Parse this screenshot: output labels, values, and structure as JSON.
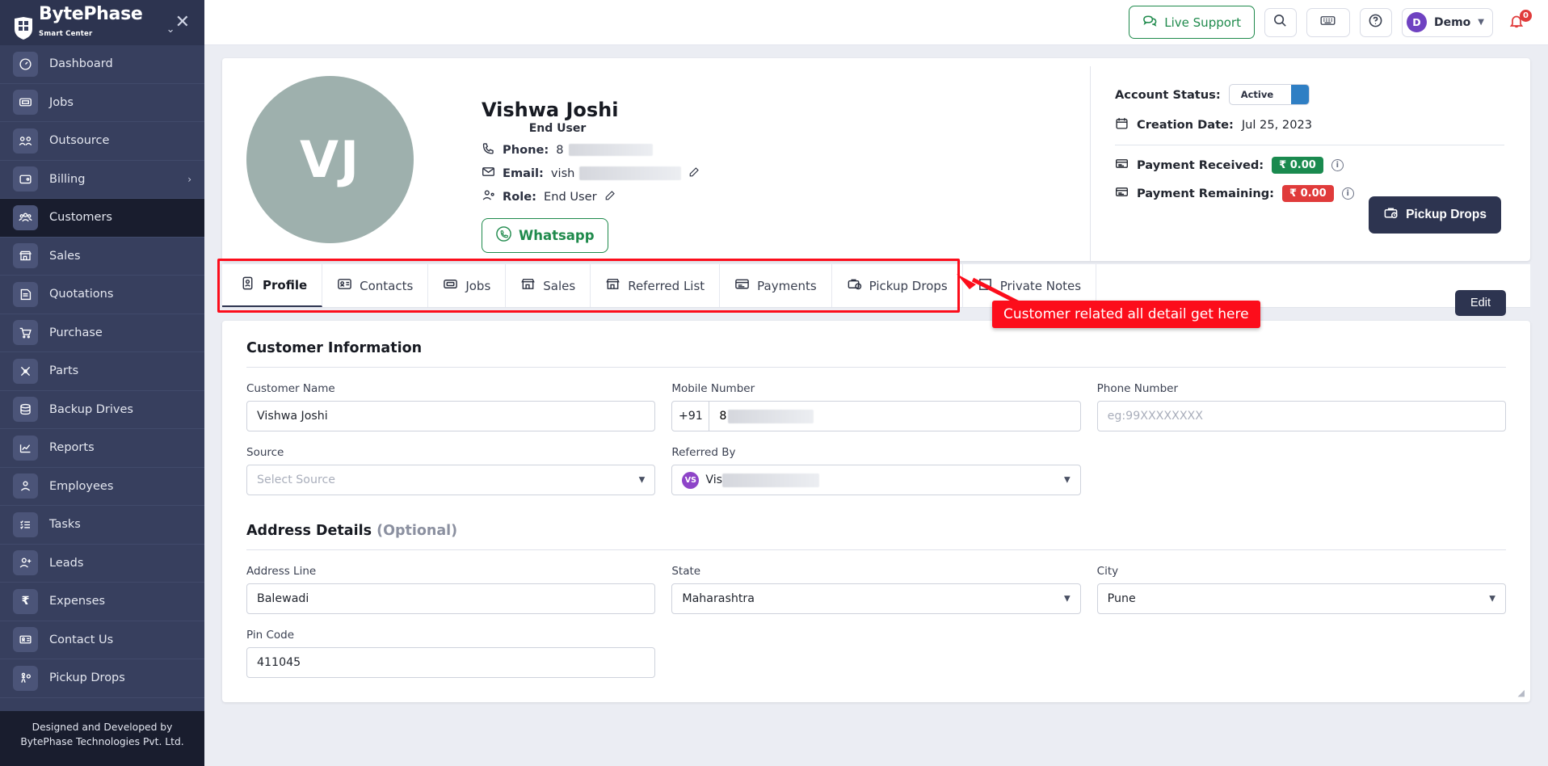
{
  "sidebar": {
    "brand": {
      "name": "BytePhase",
      "sub": "Smart Center"
    },
    "items": [
      {
        "label": "Dashboard",
        "icon": "dashboard-icon"
      },
      {
        "label": "Jobs",
        "icon": "jobs-icon"
      },
      {
        "label": "Outsource",
        "icon": "outsource-icon"
      },
      {
        "label": "Billing",
        "icon": "billing-icon",
        "chevron": "›"
      },
      {
        "label": "Customers",
        "icon": "customers-icon",
        "active": true
      },
      {
        "label": "Sales",
        "icon": "sales-icon"
      },
      {
        "label": "Quotations",
        "icon": "quotations-icon"
      },
      {
        "label": "Purchase",
        "icon": "purchase-icon"
      },
      {
        "label": "Parts",
        "icon": "parts-icon"
      },
      {
        "label": "Backup Drives",
        "icon": "backup-drives-icon"
      },
      {
        "label": "Reports",
        "icon": "reports-icon"
      },
      {
        "label": "Employees",
        "icon": "employees-icon"
      },
      {
        "label": "Tasks",
        "icon": "tasks-icon"
      },
      {
        "label": "Leads",
        "icon": "leads-icon"
      },
      {
        "label": "Expenses",
        "icon": "expenses-icon"
      },
      {
        "label": "Contact Us",
        "icon": "contact-us-icon"
      },
      {
        "label": "Pickup Drops",
        "icon": "pickup-drops-icon"
      }
    ],
    "footer": "Designed and Developed by BytePhase Technologies Pvt. Ltd."
  },
  "topbar": {
    "live_support": "Live Support",
    "user_initial": "D",
    "user_name": "Demo",
    "notification_count": "0"
  },
  "profile": {
    "initials": "VJ",
    "name": "Vishwa Joshi",
    "role_small": "End User",
    "phone_label": "Phone:",
    "phone_value": "8",
    "email_label": "Email:",
    "email_value": "vish",
    "role_label": "Role:",
    "role_value": "End User",
    "whatsapp": "Whatsapp",
    "pickup_drops": "Pickup Drops"
  },
  "account": {
    "status_label": "Account Status:",
    "status_value": "Active",
    "creation_label": "Creation Date:",
    "creation_value": "Jul 25, 2023",
    "payment_received_label": "Payment Received:",
    "payment_received_value": "₹ 0.00",
    "payment_remaining_label": "Payment Remaining:",
    "payment_remaining_value": "₹ 0.00"
  },
  "tabs": [
    {
      "label": "Profile",
      "icon": "profile-tab-icon",
      "active": true
    },
    {
      "label": "Contacts",
      "icon": "contacts-tab-icon"
    },
    {
      "label": "Jobs",
      "icon": "jobs-tab-icon"
    },
    {
      "label": "Sales",
      "icon": "sales-tab-icon"
    },
    {
      "label": "Referred List",
      "icon": "referred-list-tab-icon"
    },
    {
      "label": "Payments",
      "icon": "payments-tab-icon"
    },
    {
      "label": "Pickup Drops",
      "icon": "pickup-drops-tab-icon"
    },
    {
      "label": "Private Notes",
      "icon": "private-notes-tab-icon"
    }
  ],
  "annotation": {
    "text": "Customer related all detail get here"
  },
  "form": {
    "edit_label": "Edit",
    "section_customer": "Customer Information",
    "section_address": "Address Details",
    "section_address_optional": "(Optional)",
    "customer_name_label": "Customer Name",
    "customer_name_value": "Vishwa Joshi",
    "mobile_label": "Mobile Number",
    "mobile_country_code": "+91",
    "mobile_value": "8",
    "phone_label": "Phone Number",
    "phone_placeholder": "eg:99XXXXXXXX",
    "source_label": "Source",
    "source_placeholder": "Select Source",
    "referred_by_label": "Referred By",
    "referred_by_initials": "VS",
    "referred_by_value": "Vis",
    "address_line_label": "Address Line",
    "address_line_value": "Balewadi",
    "state_label": "State",
    "state_value": "Maharashtra",
    "city_label": "City",
    "city_value": "Pune",
    "pin_label": "Pin Code",
    "pin_value": "411045"
  }
}
